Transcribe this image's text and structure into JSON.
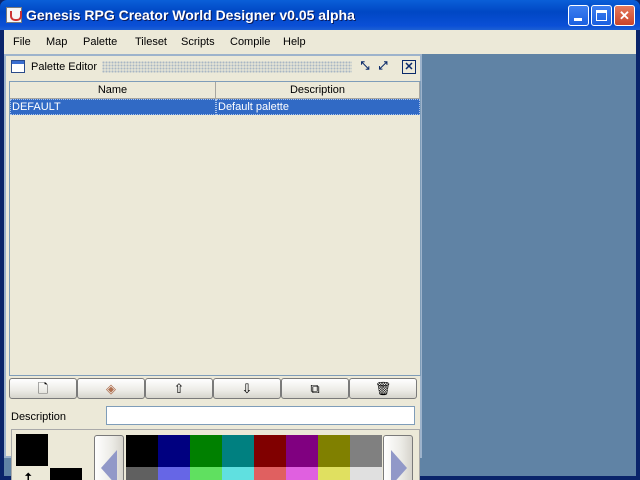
{
  "window": {
    "title": "Genesis RPG Creator World Designer v0.05 alpha"
  },
  "menu": [
    "File",
    "Map",
    "Palette",
    "Tileset",
    "Scripts",
    "Compile",
    "Help"
  ],
  "palette_editor": {
    "title": "Palette Editor",
    "columns": [
      "Name",
      "Description"
    ],
    "rows": [
      {
        "name": "DEFAULT",
        "description": "Default palette"
      }
    ],
    "toolbar": [
      "new-icon",
      "edit-icon",
      "move-up-icon",
      "move-down-icon",
      "copy-icon",
      "delete-icon"
    ],
    "description_label": "Description",
    "description_value": "",
    "fg_color": "#000000",
    "bg_color": "#000000",
    "colors": [
      "#000000",
      "#000080",
      "#008000",
      "#008080",
      "#800000",
      "#800080",
      "#808000",
      "#808080",
      "#606060",
      "#6666e6",
      "#60e060",
      "#60e0e0",
      "#e06060",
      "#e060e0",
      "#e0e060",
      "#e0e0e0"
    ]
  },
  "desktop_color": "#6083a5"
}
